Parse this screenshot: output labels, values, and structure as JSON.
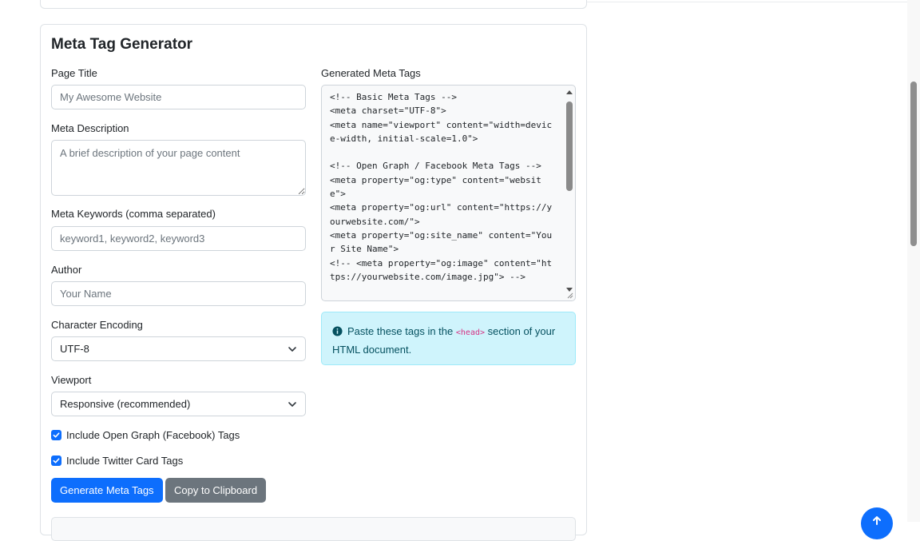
{
  "form": {
    "title": "Meta Tag Generator",
    "page_title": {
      "label": "Page Title",
      "placeholder": "My Awesome Website"
    },
    "meta_description": {
      "label": "Meta Description",
      "placeholder": "A brief description of your page content"
    },
    "meta_keywords": {
      "label": "Meta Keywords (comma separated)",
      "placeholder": "keyword1, keyword2, keyword3"
    },
    "author": {
      "label": "Author",
      "placeholder": "Your Name"
    },
    "character_encoding": {
      "label": "Character Encoding",
      "value": "UTF-8"
    },
    "viewport": {
      "label": "Viewport",
      "value": "Responsive (recommended)"
    },
    "open_graph": {
      "label": "Include Open Graph (Facebook) Tags",
      "checked": true
    },
    "twitter": {
      "label": "Include Twitter Card Tags",
      "checked": true
    },
    "generate_label": "Generate Meta Tags",
    "copy_label": "Copy to Clipboard"
  },
  "output": {
    "label": "Generated Meta Tags",
    "code": "<!-- Basic Meta Tags -->\n<meta charset=\"UTF-8\">\n<meta name=\"viewport\" content=\"width=device-width, initial-scale=1.0\">\n\n<!-- Open Graph / Facebook Meta Tags -->\n<meta property=\"og:type\" content=\"website\">\n<meta property=\"og:url\" content=\"https://yourwebsite.com/\">\n<meta property=\"og:site_name\" content=\"Your Site Name\">\n<!-- <meta property=\"og:image\" content=\"https://yourwebsite.com/image.jpg\"> -->",
    "alert_before": "Paste these tags in the",
    "alert_code": "<head>",
    "alert_after": "section of your HTML document."
  },
  "colors": {
    "primary": "#0d6efd",
    "secondary": "#6c757d",
    "info_bg": "#cff4fc",
    "info_text": "#055160"
  },
  "icons": {
    "select_arrow": "chevron-down-icon",
    "checkbox": "check-icon",
    "alert": "info-circle-icon",
    "scroll_top": "arrow-up-icon"
  }
}
